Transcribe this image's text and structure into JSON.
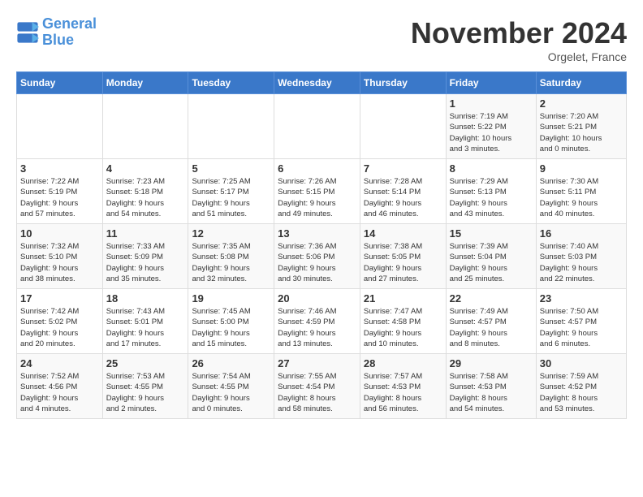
{
  "logo": {
    "line1": "General",
    "line2": "Blue"
  },
  "title": "November 2024",
  "subtitle": "Orgelet, France",
  "days_of_week": [
    "Sunday",
    "Monday",
    "Tuesday",
    "Wednesday",
    "Thursday",
    "Friday",
    "Saturday"
  ],
  "weeks": [
    [
      {
        "day": "",
        "info": ""
      },
      {
        "day": "",
        "info": ""
      },
      {
        "day": "",
        "info": ""
      },
      {
        "day": "",
        "info": ""
      },
      {
        "day": "",
        "info": ""
      },
      {
        "day": "1",
        "info": "Sunrise: 7:19 AM\nSunset: 5:22 PM\nDaylight: 10 hours\nand 3 minutes."
      },
      {
        "day": "2",
        "info": "Sunrise: 7:20 AM\nSunset: 5:21 PM\nDaylight: 10 hours\nand 0 minutes."
      }
    ],
    [
      {
        "day": "3",
        "info": "Sunrise: 7:22 AM\nSunset: 5:19 PM\nDaylight: 9 hours\nand 57 minutes."
      },
      {
        "day": "4",
        "info": "Sunrise: 7:23 AM\nSunset: 5:18 PM\nDaylight: 9 hours\nand 54 minutes."
      },
      {
        "day": "5",
        "info": "Sunrise: 7:25 AM\nSunset: 5:17 PM\nDaylight: 9 hours\nand 51 minutes."
      },
      {
        "day": "6",
        "info": "Sunrise: 7:26 AM\nSunset: 5:15 PM\nDaylight: 9 hours\nand 49 minutes."
      },
      {
        "day": "7",
        "info": "Sunrise: 7:28 AM\nSunset: 5:14 PM\nDaylight: 9 hours\nand 46 minutes."
      },
      {
        "day": "8",
        "info": "Sunrise: 7:29 AM\nSunset: 5:13 PM\nDaylight: 9 hours\nand 43 minutes."
      },
      {
        "day": "9",
        "info": "Sunrise: 7:30 AM\nSunset: 5:11 PM\nDaylight: 9 hours\nand 40 minutes."
      }
    ],
    [
      {
        "day": "10",
        "info": "Sunrise: 7:32 AM\nSunset: 5:10 PM\nDaylight: 9 hours\nand 38 minutes."
      },
      {
        "day": "11",
        "info": "Sunrise: 7:33 AM\nSunset: 5:09 PM\nDaylight: 9 hours\nand 35 minutes."
      },
      {
        "day": "12",
        "info": "Sunrise: 7:35 AM\nSunset: 5:08 PM\nDaylight: 9 hours\nand 32 minutes."
      },
      {
        "day": "13",
        "info": "Sunrise: 7:36 AM\nSunset: 5:06 PM\nDaylight: 9 hours\nand 30 minutes."
      },
      {
        "day": "14",
        "info": "Sunrise: 7:38 AM\nSunset: 5:05 PM\nDaylight: 9 hours\nand 27 minutes."
      },
      {
        "day": "15",
        "info": "Sunrise: 7:39 AM\nSunset: 5:04 PM\nDaylight: 9 hours\nand 25 minutes."
      },
      {
        "day": "16",
        "info": "Sunrise: 7:40 AM\nSunset: 5:03 PM\nDaylight: 9 hours\nand 22 minutes."
      }
    ],
    [
      {
        "day": "17",
        "info": "Sunrise: 7:42 AM\nSunset: 5:02 PM\nDaylight: 9 hours\nand 20 minutes."
      },
      {
        "day": "18",
        "info": "Sunrise: 7:43 AM\nSunset: 5:01 PM\nDaylight: 9 hours\nand 17 minutes."
      },
      {
        "day": "19",
        "info": "Sunrise: 7:45 AM\nSunset: 5:00 PM\nDaylight: 9 hours\nand 15 minutes."
      },
      {
        "day": "20",
        "info": "Sunrise: 7:46 AM\nSunset: 4:59 PM\nDaylight: 9 hours\nand 13 minutes."
      },
      {
        "day": "21",
        "info": "Sunrise: 7:47 AM\nSunset: 4:58 PM\nDaylight: 9 hours\nand 10 minutes."
      },
      {
        "day": "22",
        "info": "Sunrise: 7:49 AM\nSunset: 4:57 PM\nDaylight: 9 hours\nand 8 minutes."
      },
      {
        "day": "23",
        "info": "Sunrise: 7:50 AM\nSunset: 4:57 PM\nDaylight: 9 hours\nand 6 minutes."
      }
    ],
    [
      {
        "day": "24",
        "info": "Sunrise: 7:52 AM\nSunset: 4:56 PM\nDaylight: 9 hours\nand 4 minutes."
      },
      {
        "day": "25",
        "info": "Sunrise: 7:53 AM\nSunset: 4:55 PM\nDaylight: 9 hours\nand 2 minutes."
      },
      {
        "day": "26",
        "info": "Sunrise: 7:54 AM\nSunset: 4:55 PM\nDaylight: 9 hours\nand 0 minutes."
      },
      {
        "day": "27",
        "info": "Sunrise: 7:55 AM\nSunset: 4:54 PM\nDaylight: 8 hours\nand 58 minutes."
      },
      {
        "day": "28",
        "info": "Sunrise: 7:57 AM\nSunset: 4:53 PM\nDaylight: 8 hours\nand 56 minutes."
      },
      {
        "day": "29",
        "info": "Sunrise: 7:58 AM\nSunset: 4:53 PM\nDaylight: 8 hours\nand 54 minutes."
      },
      {
        "day": "30",
        "info": "Sunrise: 7:59 AM\nSunset: 4:52 PM\nDaylight: 8 hours\nand 53 minutes."
      }
    ]
  ]
}
